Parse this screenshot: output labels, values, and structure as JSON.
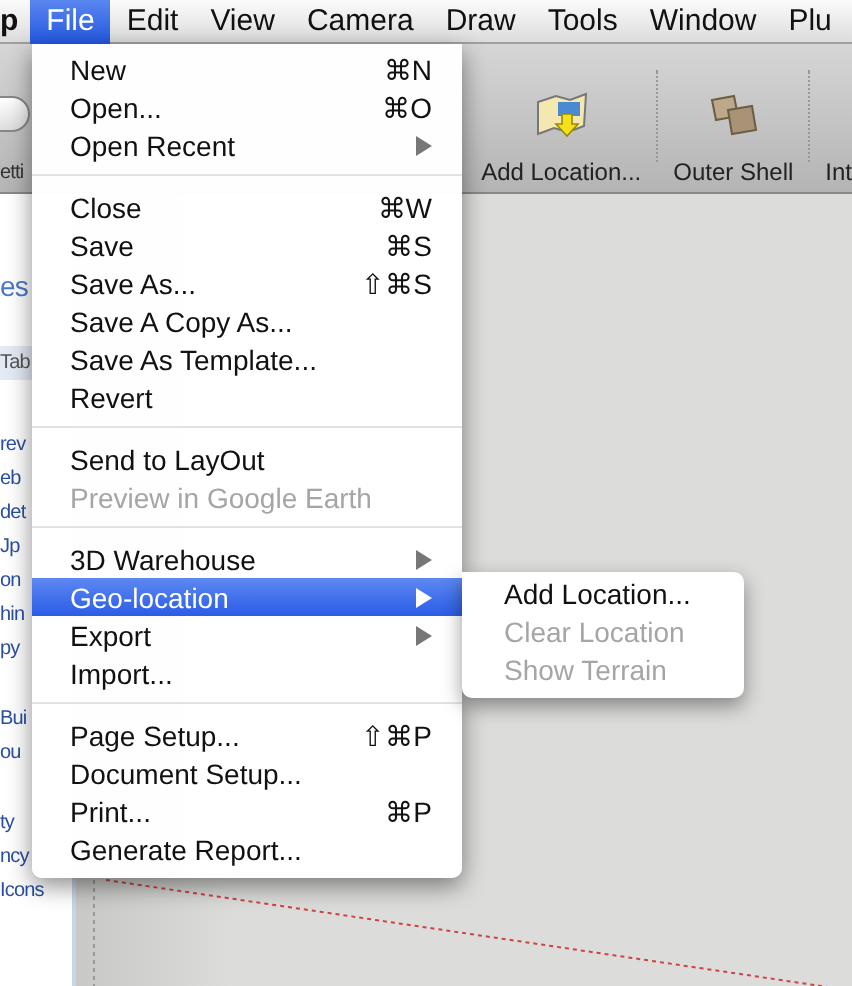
{
  "menu_bar": [
    {
      "label": "p",
      "kind": "app",
      "selected": false
    },
    {
      "label": "File",
      "kind": "menu",
      "selected": true
    },
    {
      "label": "Edit",
      "kind": "menu",
      "selected": false
    },
    {
      "label": "View",
      "kind": "menu",
      "selected": false
    },
    {
      "label": "Camera",
      "kind": "menu",
      "selected": false
    },
    {
      "label": "Draw",
      "kind": "menu",
      "selected": false
    },
    {
      "label": "Tools",
      "kind": "menu",
      "selected": false
    },
    {
      "label": "Window",
      "kind": "menu",
      "selected": false
    },
    {
      "label": "Plu",
      "kind": "menu",
      "selected": false
    }
  ],
  "toolbar": {
    "left_label": "etti",
    "buttons": [
      {
        "label": "Add Location...",
        "kind": "add-location"
      },
      {
        "label": "Outer Shell",
        "kind": "outer-shell"
      },
      {
        "label": "Int",
        "kind": "cut"
      }
    ]
  },
  "sidebar": {
    "groups": [
      {
        "kind": "heading",
        "lines": [
          "es"
        ]
      },
      {
        "kind": "tab",
        "lines": [
          "Tab"
        ]
      },
      {
        "kind": "links",
        "lines": [
          "rev",
          "eb",
          "det",
          "Jp",
          "on",
          "hin",
          "py"
        ]
      },
      {
        "kind": "links",
        "lines": [
          "Bui",
          "ou"
        ]
      },
      {
        "kind": "links",
        "lines": [
          "ty",
          "ncy",
          "Icons"
        ]
      }
    ]
  },
  "file_menu": [
    {
      "kind": "item",
      "label": "New",
      "shortcut": "⌘N",
      "submenu": false,
      "disabled": false,
      "selected": false
    },
    {
      "kind": "item",
      "label": "Open...",
      "shortcut": "⌘O",
      "submenu": false,
      "disabled": false,
      "selected": false
    },
    {
      "kind": "item",
      "label": "Open Recent",
      "submenu": true,
      "disabled": false,
      "selected": false
    },
    {
      "kind": "separator"
    },
    {
      "kind": "item",
      "label": "Close",
      "shortcut": "⌘W",
      "submenu": false,
      "disabled": false,
      "selected": false
    },
    {
      "kind": "item",
      "label": "Save",
      "shortcut": "⌘S",
      "submenu": false,
      "disabled": false,
      "selected": false
    },
    {
      "kind": "item",
      "label": "Save As...",
      "shortcut": "⇧⌘S",
      "submenu": false,
      "disabled": false,
      "selected": false
    },
    {
      "kind": "item",
      "label": "Save A Copy As...",
      "submenu": false,
      "disabled": false,
      "selected": false
    },
    {
      "kind": "item",
      "label": "Save As Template...",
      "submenu": false,
      "disabled": false,
      "selected": false
    },
    {
      "kind": "item",
      "label": "Revert",
      "submenu": false,
      "disabled": false,
      "selected": false
    },
    {
      "kind": "separator"
    },
    {
      "kind": "item",
      "label": "Send to LayOut",
      "submenu": false,
      "disabled": false,
      "selected": false
    },
    {
      "kind": "item",
      "label": "Preview in Google Earth",
      "submenu": false,
      "disabled": true,
      "selected": false
    },
    {
      "kind": "separator"
    },
    {
      "kind": "item",
      "label": "3D Warehouse",
      "submenu": true,
      "disabled": false,
      "selected": false
    },
    {
      "kind": "item",
      "label": "Geo-location",
      "submenu": true,
      "disabled": false,
      "selected": true
    },
    {
      "kind": "item",
      "label": "Export",
      "submenu": true,
      "disabled": false,
      "selected": false
    },
    {
      "kind": "item",
      "label": "Import...",
      "submenu": false,
      "disabled": false,
      "selected": false
    },
    {
      "kind": "separator"
    },
    {
      "kind": "item",
      "label": "Page Setup...",
      "shortcut": "⇧⌘P",
      "submenu": false,
      "disabled": false,
      "selected": false
    },
    {
      "kind": "item",
      "label": "Document Setup...",
      "submenu": false,
      "disabled": false,
      "selected": false
    },
    {
      "kind": "item",
      "label": "Print...",
      "shortcut": "⌘P",
      "submenu": false,
      "disabled": false,
      "selected": false
    },
    {
      "kind": "item",
      "label": "Generate Report...",
      "submenu": false,
      "disabled": false,
      "selected": false
    }
  ],
  "geo_location_submenu": [
    {
      "label": "Add Location...",
      "disabled": false
    },
    {
      "label": "Clear Location",
      "disabled": true
    },
    {
      "label": "Show Terrain",
      "disabled": true
    }
  ]
}
